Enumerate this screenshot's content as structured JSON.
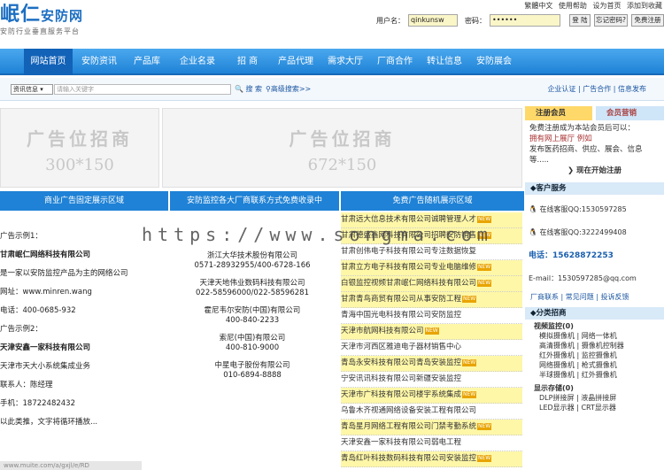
{
  "logo": {
    "name": "岷仁",
    "name_suffix": "安防网",
    "slogan": "安防行业垂直服务平台"
  },
  "toplinks": [
    "繁體中文",
    "使用帮助",
    "设为首页",
    "添加到收藏"
  ],
  "login": {
    "user_label": "用户名：",
    "user_value": "qinkunsw",
    "pass_label": "密码：",
    "pass_value": "••••••",
    "login_btn": "登 陆",
    "forgot_btn": "忘记密码?",
    "register_btn": "免费注册"
  },
  "nav": [
    "网站首页",
    "安防资讯",
    "产品库",
    "企业名录",
    "招 商",
    "产品代理",
    "需求大厅",
    "厂商合作",
    "转让信息",
    "安防展会"
  ],
  "search": {
    "select": "资讯信息 ▾",
    "placeholder": "请输入关键字",
    "go": "搜 索",
    "advanced": "高级搜索>>",
    "right": "企业认证 | 广告合作 | 信息发布"
  },
  "ads": [
    {
      "title": "广告位招商",
      "size": "300*150"
    },
    {
      "title": "广告位招商",
      "size": "672*150"
    }
  ],
  "columns": [
    "商业广告固定展示区域",
    "安防监控各大厂商联系方式免费收录中",
    "免费广告随机展示区域"
  ],
  "col1": [
    {
      "t": "广告示例1：",
      "b": false
    },
    {
      "t": "甘肃岷仁网络科技有限公司",
      "b": true
    },
    {
      "t": "是一家以安防监控产品为主的网络公司",
      "b": false
    },
    {
      "t": "网址：www.minren.wang",
      "b": false
    },
    {
      "t": "电话：400-0685-932",
      "b": false
    },
    {
      "t": "广告示例2：",
      "b": false
    },
    {
      "t": "天津安鑫一家科技有限公司",
      "b": true
    },
    {
      "t": "天津市天大小系统集成业务",
      "b": false
    },
    {
      "t": "联系人：陈经理",
      "b": false
    },
    {
      "t": "手机：18722482432",
      "b": false
    },
    {
      "t": "以此类推，文字将循环播放...",
      "b": false
    }
  ],
  "col2": [
    [
      "浙江大华技术股份有限公司",
      "0571-28932955/400-6728-166"
    ],
    [
      "天津天地伟业数码科技有限公司",
      "022-58596000/022-58596281"
    ],
    [
      "霍尼韦尔安防(中国)有限公司",
      "400-840-2233"
    ],
    [
      "索尼(中国)有限公司",
      "400-810-9000"
    ],
    [
      "中星电子股份有限公司",
      "010-6894-8888"
    ]
  ],
  "col3": [
    {
      "t": "甘肃远大信息技术有限公司诚聘管理人才",
      "hl": true
    },
    {
      "t": "甘肃德盛鑫网科技有限公司招聘安防销售",
      "hl": true
    },
    {
      "t": "甘肃创伟电子科技有限公司专注数据恢复",
      "hl": false
    },
    {
      "t": "甘肃立方电子科技有限公司专业电脑维修",
      "hl": true
    },
    {
      "t": "白银监控视频甘肃岷仁网络科技有限公司",
      "hl": true
    },
    {
      "t": "甘肃青鸟商贸有限公司从事安防工程",
      "hl": true
    },
    {
      "t": "青海中国光电科技有限公司安防监控",
      "hl": false
    },
    {
      "t": "天津市航网科技有限公司",
      "hl": true
    },
    {
      "t": "天津市河西区雅迪电子器材销售中心",
      "hl": false
    },
    {
      "t": "青岛永安科技有限公司青岛安装监控",
      "hl": true
    },
    {
      "t": "宁安讯讯科技有限公司新疆安装监控",
      "hl": false
    },
    {
      "t": "天津市广科技有限公司楼宇系统集成",
      "hl": true
    },
    {
      "t": "乌鲁木齐视通网络设备安装工程有限公司",
      "hl": false
    },
    {
      "t": "青岛星月网络工程有限公司门禁考勤系统",
      "hl": true
    },
    {
      "t": "天津安鑫一家科技有限公司弱电工程",
      "hl": false
    },
    {
      "t": "青岛红叶科技数码科技有限公司安装监控",
      "hl": true
    }
  ],
  "side": {
    "tab1": "注册会员",
    "tab2": "会员营销",
    "intro": [
      "免费注册成为本站会员后可以：",
      "拥有网上展厅 例如",
      "发布医药招商、供应、展会、信息等.....",
      "现在开始注册"
    ],
    "service_title": "客户服务",
    "qq1": "在线客服QQ:1530597285",
    "qq2": "在线客服QQ:3222499408",
    "phone": "电话：15628872253",
    "email": "E-mail：1530597285@qq.com",
    "links": "厂商联系 | 常见问题 | 投诉反馈",
    "cat_title": "分类招商",
    "cat1": "视频监控(0)",
    "cat1_items": [
      "模拟摄像机 | 网络一体机",
      "高清摄像机 | 摄像机控制器",
      "红外摄像机 | 监控摄像机",
      "网络摄像机 | 枪式摄像机",
      "半球摄像机 | 红外摄像机"
    ],
    "cat2": "显示存储(0)",
    "cat2_items": [
      "DLP拼接屏 | 液晶拼接屏",
      "LED显示器 | CRT显示器"
    ]
  },
  "watermark": "https://www.songma.com",
  "statusbar": "www.muite.com/a/gxjl/e/RD"
}
